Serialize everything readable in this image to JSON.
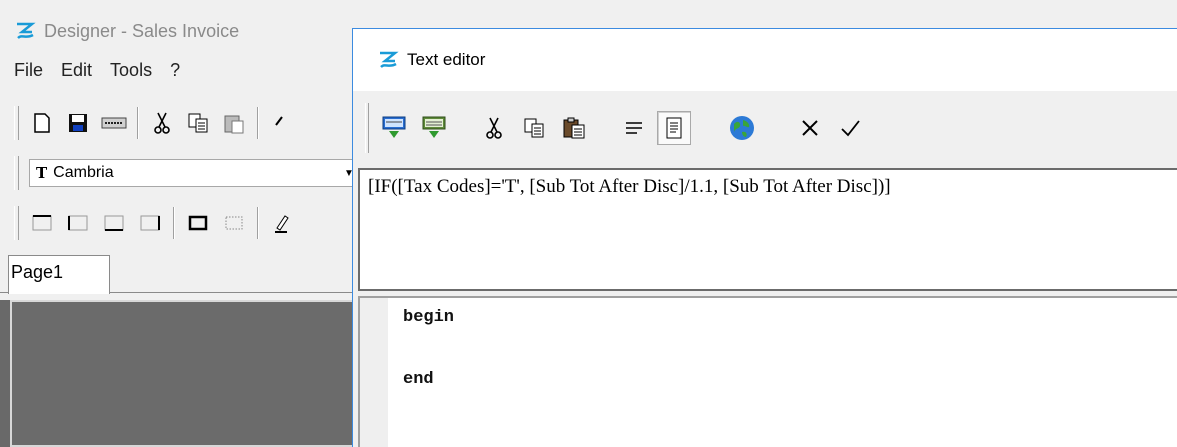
{
  "designer": {
    "title": "Designer - Sales Invoice",
    "menu": [
      "File",
      "Edit",
      "Tools",
      "?"
    ],
    "toolbar1": [
      "new-document-icon",
      "save-icon",
      "page-setup-icon",
      "cut-icon",
      "copy-icon",
      "paste-icon",
      "undo-icon"
    ],
    "font_combo": {
      "value": "Cambria",
      "icon": "T"
    },
    "toolbar3": [
      "frame-top-icon",
      "frame-left-icon",
      "frame-bottom-icon",
      "frame-right-icon",
      "frame-all-icon",
      "frame-none-icon",
      "frame-style-icon"
    ],
    "page_tab": "Page1"
  },
  "editor": {
    "title": "Text editor",
    "toolbar": [
      "insert-expression-icon",
      "insert-aggregate-icon",
      "cut-icon",
      "copy-icon",
      "paste-icon",
      "word-wrap-icon",
      "script-view-icon",
      "globe-icon",
      "cancel-icon",
      "ok-icon"
    ],
    "expression": "[IF([Tax Codes]='T', [Sub Tot After Disc]/1.1, [Sub Tot After Disc])]",
    "script": {
      "line1": "begin",
      "line2": "end"
    }
  },
  "colors": {
    "accent": "#3c8be0",
    "page_background": "#6b6b6b",
    "logo": "#1a9bd7"
  }
}
